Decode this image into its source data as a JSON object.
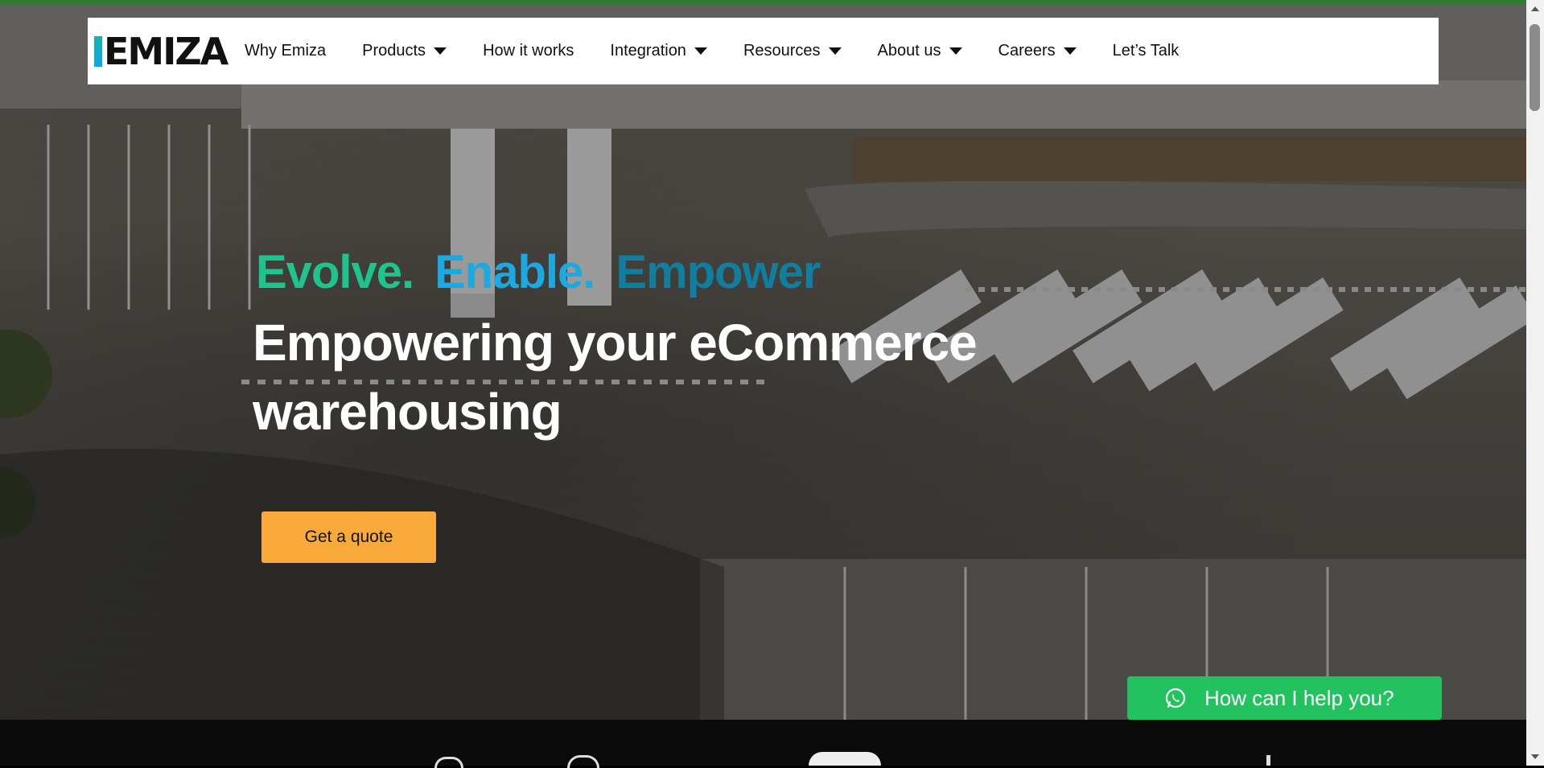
{
  "nav": {
    "logo_text": "EMIZA",
    "items": [
      {
        "label": "Why Emiza",
        "has_dropdown": false
      },
      {
        "label": "Products",
        "has_dropdown": true
      },
      {
        "label": "How it works",
        "has_dropdown": false
      },
      {
        "label": "Integration",
        "has_dropdown": true
      },
      {
        "label": "Resources",
        "has_dropdown": true
      },
      {
        "label": "About us",
        "has_dropdown": true
      },
      {
        "label": "Careers",
        "has_dropdown": true
      },
      {
        "label": "Let’s Talk",
        "has_dropdown": false
      }
    ]
  },
  "hero": {
    "tagline": [
      {
        "text": "Evolve.",
        "color": "#1ec48e"
      },
      {
        "text": "Enable.",
        "color": "#1aa9e0"
      },
      {
        "text": "Empower",
        "color": "#0e7f9e"
      }
    ],
    "headline": "Empowering your eCommerce warehousing",
    "cta_label": "Get a quote"
  },
  "chat": {
    "label": "How can I help you?",
    "icon": "whatsapp-icon"
  },
  "colors": {
    "top_accent": "#2e7d32",
    "cta": "#f8a93a",
    "chat": "#22c35e"
  }
}
